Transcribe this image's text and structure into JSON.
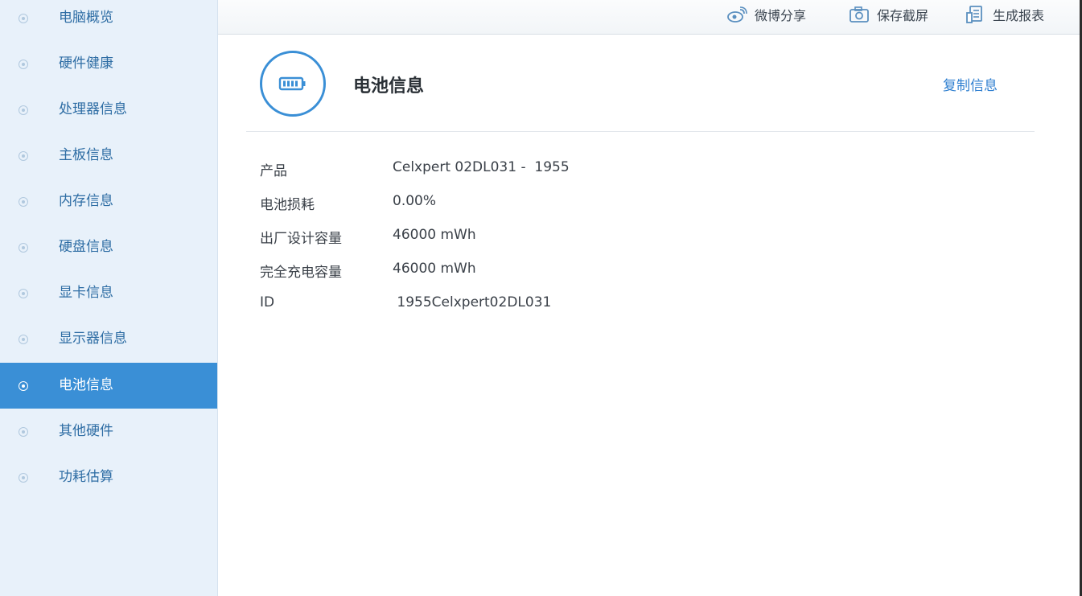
{
  "sidebar": {
    "items": [
      {
        "label": "电脑概览"
      },
      {
        "label": "硬件健康"
      },
      {
        "label": "处理器信息"
      },
      {
        "label": "主板信息"
      },
      {
        "label": "内存信息"
      },
      {
        "label": "硬盘信息"
      },
      {
        "label": "显卡信息"
      },
      {
        "label": "显示器信息"
      },
      {
        "label": "电池信息",
        "active": true
      },
      {
        "label": "其他硬件"
      },
      {
        "label": "功耗估算"
      }
    ]
  },
  "toolbar": {
    "weibo_label": "微博分享",
    "screenshot_label": "保存截屏",
    "report_label": "生成报表"
  },
  "main": {
    "title": "电池信息",
    "copy_label": "复制信息",
    "rows": [
      {
        "key": "产品",
        "value": "Celxpert 02DL031 -  1955"
      },
      {
        "key": "电池损耗",
        "value": "0.00%"
      },
      {
        "key": "出厂设计容量",
        "value": "46000 mWh"
      },
      {
        "key": "完全充电容量",
        "value": "46000 mWh"
      },
      {
        "key": "ID",
        "value": " 1955Celxpert02DL031"
      }
    ]
  },
  "colors": {
    "accent": "#3a8fd6",
    "sidebar_bg": "#e8f1fa",
    "link": "#2f7fd0"
  }
}
